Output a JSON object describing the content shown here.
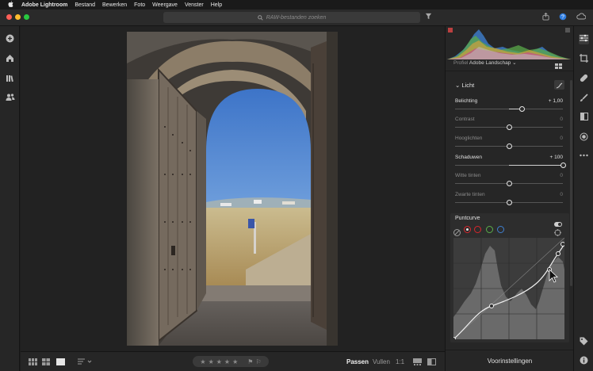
{
  "menubar": {
    "apple": "",
    "app_name": "Adobe Lightroom",
    "items": [
      "Bestand",
      "Bewerken",
      "Foto",
      "Weergave",
      "Venster",
      "Help"
    ]
  },
  "titlebar": {
    "search_placeholder": "RAW-bestanden zoeken",
    "icons": [
      "filter-icon",
      "share-icon",
      "help-icon",
      "cloud-icon"
    ]
  },
  "colors": {
    "traffic_red": "#fe5f57",
    "traffic_yellow": "#febc2e",
    "traffic_green": "#28c840",
    "accent_red": "#d8262c",
    "panel_bg": "#262626"
  },
  "left_rail": {
    "icons": [
      "add-icon",
      "home-icon",
      "library-icon",
      "people-icon"
    ]
  },
  "right_rail": {
    "icons": [
      "edit-sliders-icon",
      "crop-icon",
      "healing-icon",
      "brush-icon",
      "gradient-icon",
      "radial-icon",
      "more-icon",
      "tag-icon",
      "info-icon"
    ]
  },
  "profile": {
    "label": "Profiel",
    "value": "Adobe Landschap"
  },
  "light": {
    "title": "Licht",
    "sliders": [
      {
        "label": "Belichting",
        "value": "+ 1,00",
        "level": 0.62,
        "active": true
      },
      {
        "label": "Contrast",
        "value": "0",
        "level": 0.5,
        "active": false
      },
      {
        "label": "Hooglichten",
        "value": "0",
        "level": 0.5,
        "active": false
      },
      {
        "label": "Schaduwen",
        "value": "+ 100",
        "level": 1.0,
        "active": true
      },
      {
        "label": "Witte tinten",
        "value": "0",
        "level": 0.5,
        "active": false
      },
      {
        "label": "Zwarte tinten",
        "value": "0",
        "level": 0.5,
        "active": false
      }
    ]
  },
  "point_curve": {
    "title": "Puntcurve",
    "channels": [
      "rgb",
      "red",
      "green",
      "blue"
    ],
    "selected_channel": "rgb"
  },
  "bottom": {
    "fit": "Passen",
    "fill": "Vullen",
    "ratio": "1:1",
    "presets_label": "Voorinstellingen",
    "rating_stars": 5
  }
}
